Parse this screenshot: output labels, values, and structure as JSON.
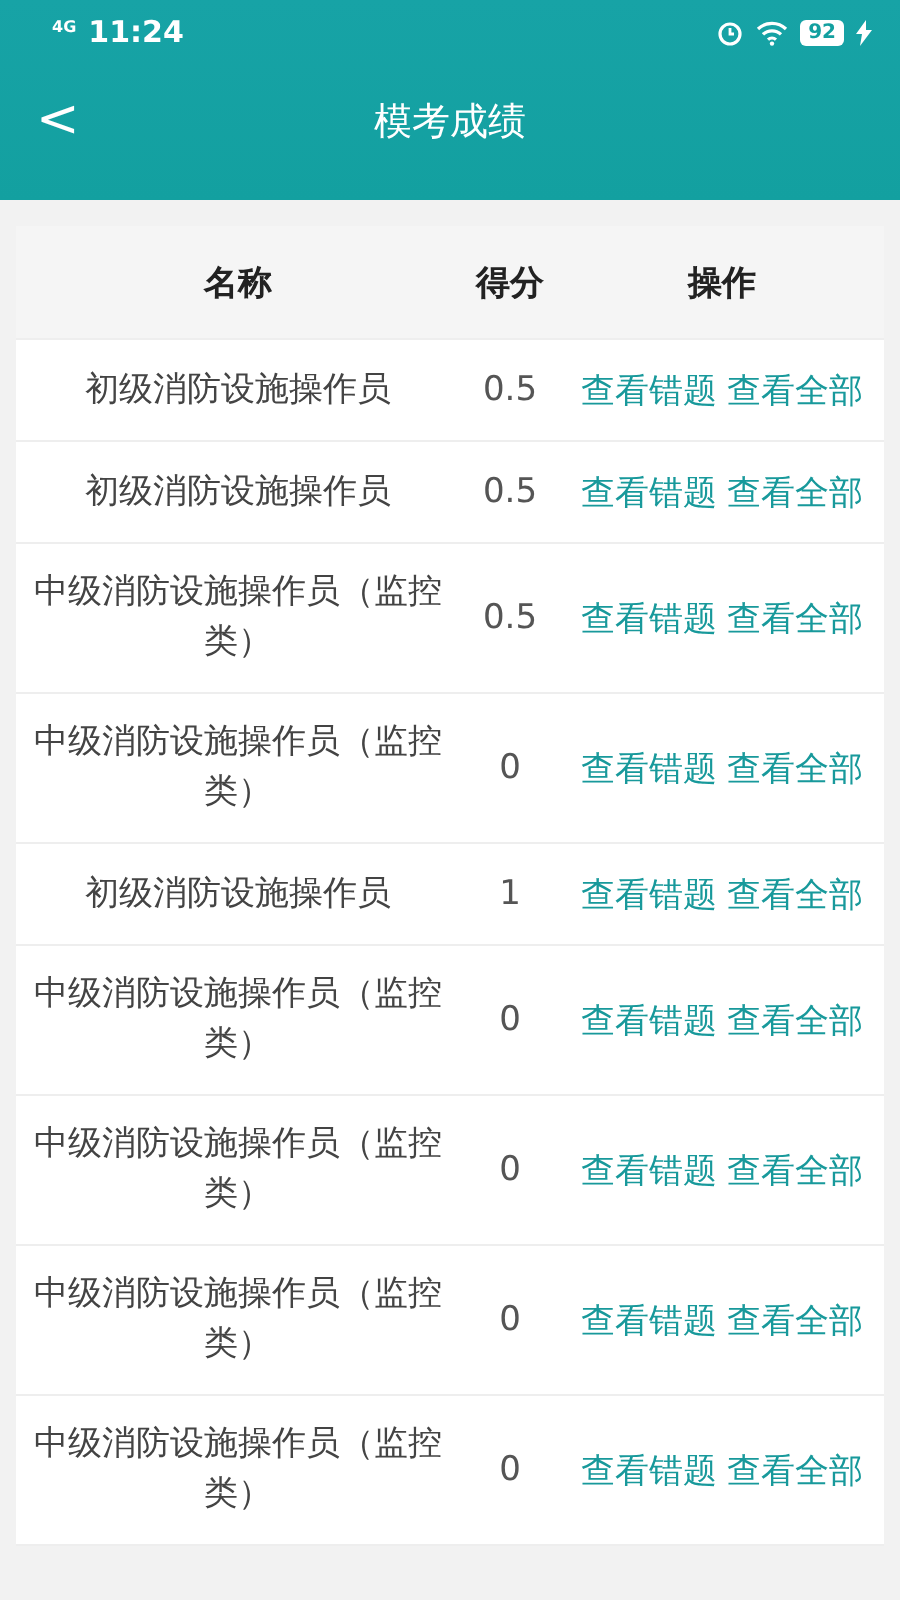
{
  "status_bar": {
    "network": "4G",
    "time": "11:24",
    "battery": "92"
  },
  "header": {
    "back": "<",
    "title": "模考成绩"
  },
  "table": {
    "columns": [
      "名称",
      "得分",
      "操作"
    ],
    "rows": [
      {
        "name": "初级消防设施操作员",
        "score": "0.5",
        "actions": [
          "查看错题",
          "查看全部"
        ]
      },
      {
        "name": "初级消防设施操作员",
        "score": "0.5",
        "actions": [
          "查看错题",
          "查看全部"
        ]
      },
      {
        "name": "中级消防设施操作员（监控类）",
        "score": "0.5",
        "actions": [
          "查看错题",
          "查看全部"
        ]
      },
      {
        "name": "中级消防设施操作员（监控类）",
        "score": "0",
        "actions": [
          "查看错题",
          "查看全部"
        ]
      },
      {
        "name": "初级消防设施操作员",
        "score": "1",
        "actions": [
          "查看错题",
          "查看全部"
        ]
      },
      {
        "name": "中级消防设施操作员（监控类）",
        "score": "0",
        "actions": [
          "查看错题",
          "查看全部"
        ]
      },
      {
        "name": "中级消防设施操作员（监控类）",
        "score": "0",
        "actions": [
          "查看错题",
          "查看全部"
        ]
      },
      {
        "name": "中级消防设施操作员（监控类）",
        "score": "0",
        "actions": [
          "查看错题",
          "查看全部"
        ]
      },
      {
        "name": "中级消防设施操作员（监控类）",
        "score": "0",
        "actions": [
          "查看错题",
          "查看全部"
        ]
      }
    ]
  }
}
